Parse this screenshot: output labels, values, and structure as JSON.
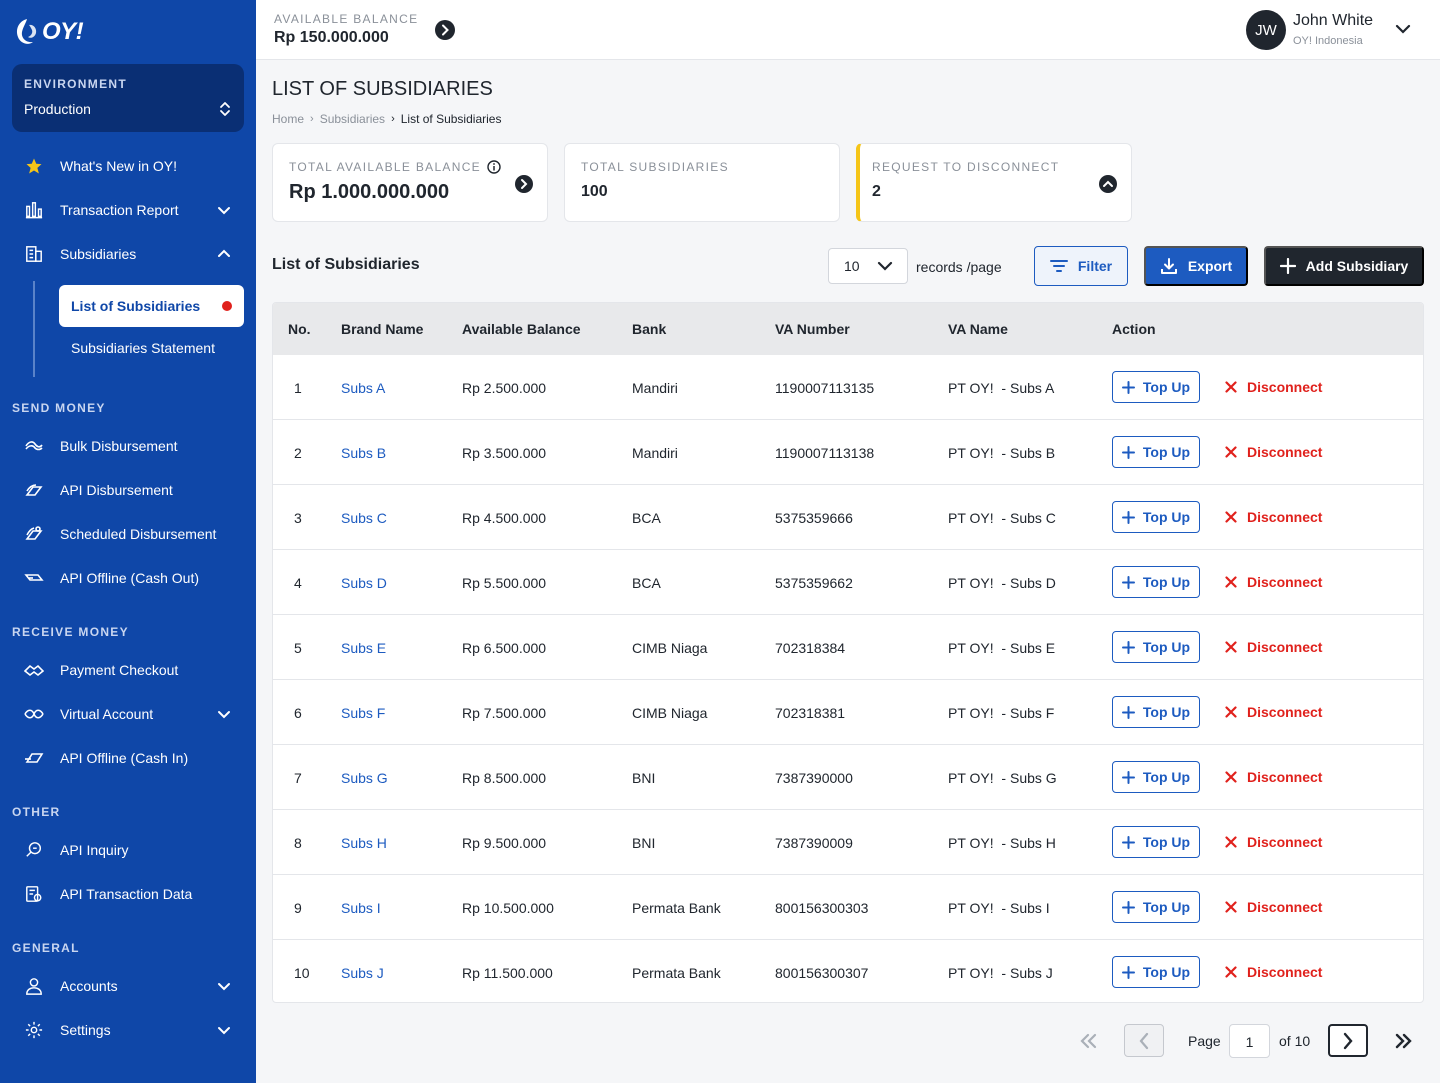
{
  "brand": {
    "logo_text": "OY!"
  },
  "environment": {
    "label": "ENVIRONMENT",
    "value": "Production"
  },
  "sidebar": {
    "top_items": [
      {
        "label": "What's New in OY!",
        "icon": "star-icon"
      },
      {
        "label": "Transaction Report",
        "icon": "bar-chart-icon"
      },
      {
        "label": "Subsidiaries",
        "icon": "building-icon"
      }
    ],
    "sub_items": [
      {
        "label": "List of Subsidiaries",
        "active": true
      },
      {
        "label": "Subsidiaries Statement"
      }
    ],
    "sections": [
      {
        "title": "SEND MONEY",
        "items": [
          {
            "label": "Bulk Disbursement",
            "icon": "money-send-icon"
          },
          {
            "label": "API Disbursement",
            "icon": "money-send-icon"
          },
          {
            "label": "Scheduled Disbursement",
            "icon": "money-send-icon"
          },
          {
            "label": "API Offline (Cash Out)",
            "icon": "cash-out-icon"
          }
        ]
      },
      {
        "title": "RECEIVE MONEY",
        "items": [
          {
            "label": "Payment Checkout",
            "icon": "handshake-icon"
          },
          {
            "label": "Virtual Account",
            "icon": "virtual-account-icon"
          },
          {
            "label": "API Offline (Cash In)",
            "icon": "cash-in-icon"
          }
        ]
      },
      {
        "title": "OTHER",
        "items": [
          {
            "label": "API Inquiry",
            "icon": "inquiry-icon"
          },
          {
            "label": "API Transaction Data",
            "icon": "transaction-data-icon"
          }
        ]
      },
      {
        "title": "GENERAL",
        "items": [
          {
            "label": "Accounts",
            "icon": "user-icon"
          },
          {
            "label": "Settings",
            "icon": "gear-icon"
          }
        ]
      }
    ]
  },
  "topbar": {
    "balance_label": "AVAILABLE BALANCE",
    "balance_value": "Rp 150.000.000",
    "user_initials": "JW",
    "user_name": "John White",
    "user_org": "OY! Indonesia"
  },
  "page": {
    "title": "LIST OF SUBSIDIARIES",
    "breadcrumb": [
      "Home",
      "Subsidiaries",
      "List of Subsidiaries"
    ]
  },
  "summary_cards": [
    {
      "label": "TOTAL AVAILABLE BALANCE",
      "value": "Rp 1.000.000.000"
    },
    {
      "label": "TOTAL SUBSIDIARIES",
      "value": "100"
    },
    {
      "label": "REQUEST TO DISCONNECT",
      "value": "2"
    }
  ],
  "list": {
    "title": "List of Subsidiaries",
    "page_size": "10",
    "records_label": "records /page",
    "filter_label": "Filter",
    "export_label": "Export",
    "add_label": "Add Subsidiary",
    "topup_label": "Top Up",
    "disconnect_label": "Disconnect",
    "columns": [
      "No.",
      "Brand Name",
      "Available Balance",
      "Bank",
      "VA Number",
      "VA Name",
      "Action"
    ],
    "rows": [
      {
        "no": "1",
        "brand": "Subs A",
        "balance": "Rp 2.500.000",
        "bank": "Mandiri",
        "va_number": "1190007113135",
        "va_name": "PT OY!  - Subs A"
      },
      {
        "no": "2",
        "brand": "Subs B",
        "balance": "Rp 3.500.000",
        "bank": "Mandiri",
        "va_number": "1190007113138",
        "va_name": "PT OY!  - Subs B"
      },
      {
        "no": "3",
        "brand": "Subs C",
        "balance": "Rp 4.500.000",
        "bank": "BCA",
        "va_number": "5375359666",
        "va_name": "PT OY!  - Subs C"
      },
      {
        "no": "4",
        "brand": "Subs D",
        "balance": "Rp 5.500.000",
        "bank": "BCA",
        "va_number": "5375359662",
        "va_name": "PT OY!  - Subs D"
      },
      {
        "no": "5",
        "brand": "Subs E",
        "balance": "Rp 6.500.000",
        "bank": "CIMB Niaga",
        "va_number": "702318384",
        "va_name": "PT OY!  - Subs E"
      },
      {
        "no": "6",
        "brand": "Subs F",
        "balance": "Rp 7.500.000",
        "bank": "CIMB Niaga",
        "va_number": "702318381",
        "va_name": "PT OY!  - Subs F"
      },
      {
        "no": "7",
        "brand": "Subs G",
        "balance": "Rp 8.500.000",
        "bank": "BNI",
        "va_number": "7387390000",
        "va_name": "PT OY!  - Subs G"
      },
      {
        "no": "8",
        "brand": "Subs H",
        "balance": "Rp 9.500.000",
        "bank": "BNI",
        "va_number": "7387390009",
        "va_name": "PT OY!  - Subs H"
      },
      {
        "no": "9",
        "brand": "Subs I",
        "balance": "Rp 10.500.000",
        "bank": "Permata Bank",
        "va_number": "800156300303",
        "va_name": "PT OY!  - Subs I"
      },
      {
        "no": "10",
        "brand": "Subs J",
        "balance": "Rp 11.500.000",
        "bank": "Permata Bank",
        "va_number": "800156300307",
        "va_name": "PT OY!  - Subs J"
      }
    ]
  },
  "pagination": {
    "page_label": "Page",
    "current": "1",
    "of_label": "of 10"
  },
  "colors": {
    "sidebar": "#0f47a8",
    "primary": "#1d5bc0",
    "danger": "#e0211c",
    "warning": "#f5c518",
    "dark": "#20262e"
  }
}
